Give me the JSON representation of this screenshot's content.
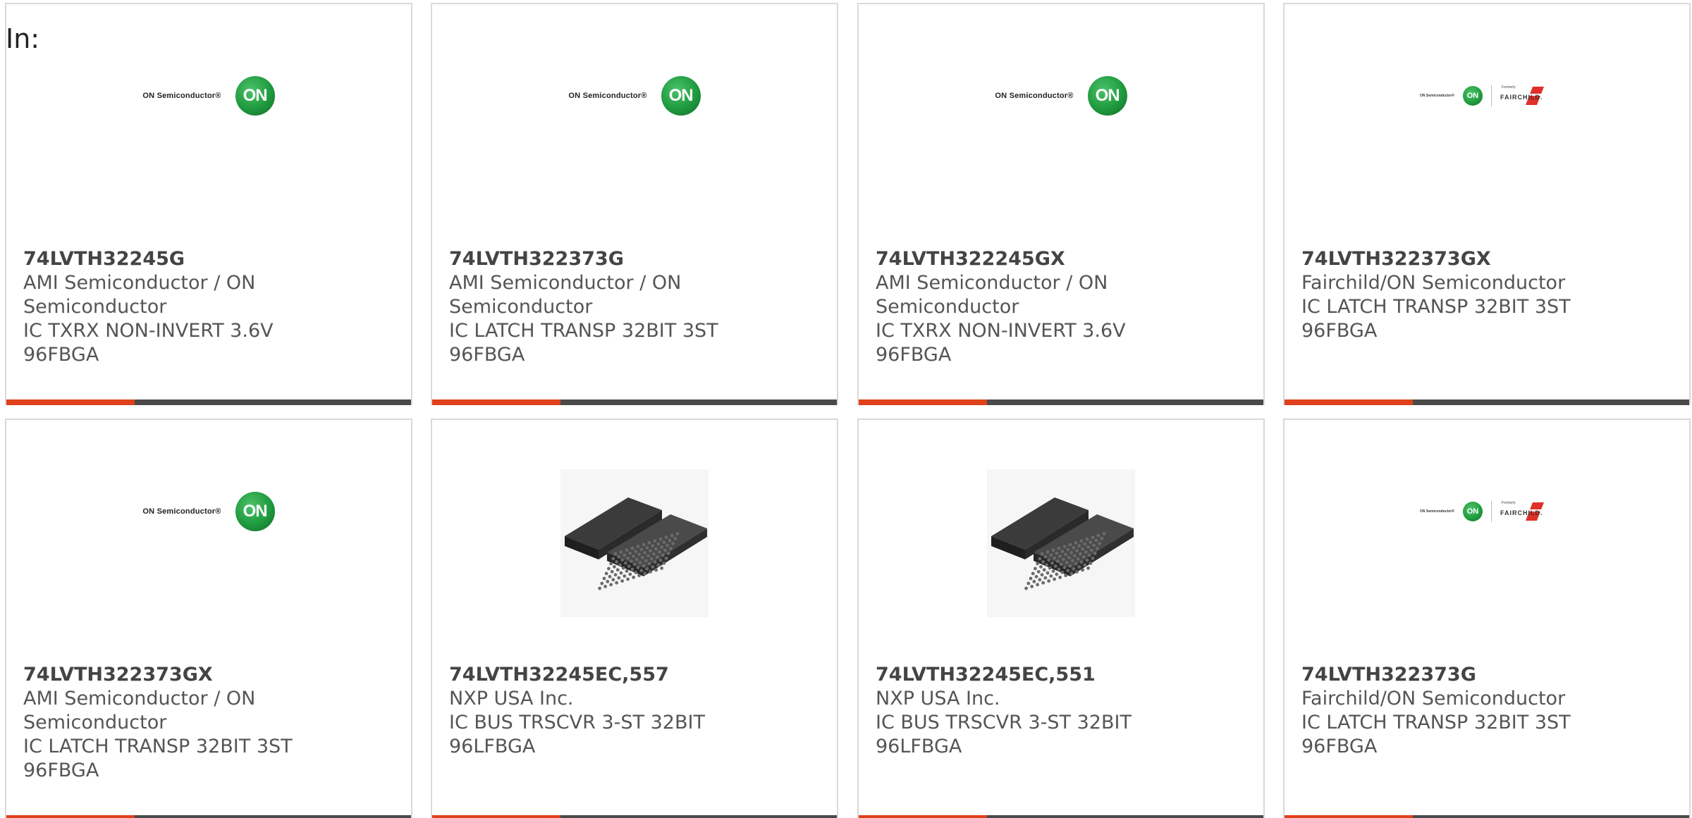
{
  "header": {
    "in_label": "In:"
  },
  "colors": {
    "accent": "#e0401a",
    "bar": "#4a4a4a",
    "border": "#d9d9d9"
  },
  "cards": [
    {
      "part_number": "74LVTH32245G",
      "manufacturer": "AMI Semiconductor / ON Semiconductor",
      "description": "IC TXRX NON-INVERT 3.6V 96FBGA",
      "image_type": "on-semiconductor-logo",
      "logo_text": "ON Semiconductor®",
      "logo_mark": "ON"
    },
    {
      "part_number": "74LVTH322373G",
      "manufacturer": "AMI Semiconductor / ON Semiconductor",
      "description": "IC LATCH TRANSP 32BIT 3ST 96FBGA",
      "image_type": "on-semiconductor-logo",
      "logo_text": "ON Semiconductor®",
      "logo_mark": "ON"
    },
    {
      "part_number": "74LVTH322245GX",
      "manufacturer": "AMI Semiconductor / ON Semiconductor",
      "description": "IC TXRX NON-INVERT 3.6V 96FBGA",
      "image_type": "on-semiconductor-logo",
      "logo_text": "ON Semiconductor®",
      "logo_mark": "ON"
    },
    {
      "part_number": "74LVTH322373GX",
      "manufacturer": "Fairchild/ON Semiconductor",
      "description": "IC LATCH TRANSP 32BIT 3ST 96FBGA",
      "image_type": "fairchild-on-logo",
      "logo_text": "ON Semiconductor®",
      "logo_mark": "ON",
      "formerly_text": "Formerly",
      "brand_text": "FAIRCHILD."
    },
    {
      "part_number": "74LVTH322373GX",
      "manufacturer": "AMI Semiconductor / ON Semiconductor",
      "description": "IC LATCH TRANSP 32BIT 3ST 96FBGA",
      "image_type": "on-semiconductor-logo",
      "logo_text": "ON Semiconductor®",
      "logo_mark": "ON"
    },
    {
      "part_number": "74LVTH32245EC,557",
      "manufacturer": "NXP USA Inc.",
      "description": "IC BUS TRSCVR 3-ST 32BIT 96LFBGA",
      "image_type": "bga-chip-photo"
    },
    {
      "part_number": "74LVTH32245EC,551",
      "manufacturer": "NXP USA Inc.",
      "description": "IC BUS TRSCVR 3-ST 32BIT 96LFBGA",
      "image_type": "bga-chip-photo"
    },
    {
      "part_number": "74LVTH322373G",
      "manufacturer": "Fairchild/ON Semiconductor",
      "description": "IC LATCH TRANSP 32BIT 3ST 96FBGA",
      "image_type": "fairchild-on-logo",
      "logo_text": "ON Semiconductor®",
      "logo_mark": "ON",
      "formerly_text": "Formerly",
      "brand_text": "FAIRCHILD."
    }
  ]
}
